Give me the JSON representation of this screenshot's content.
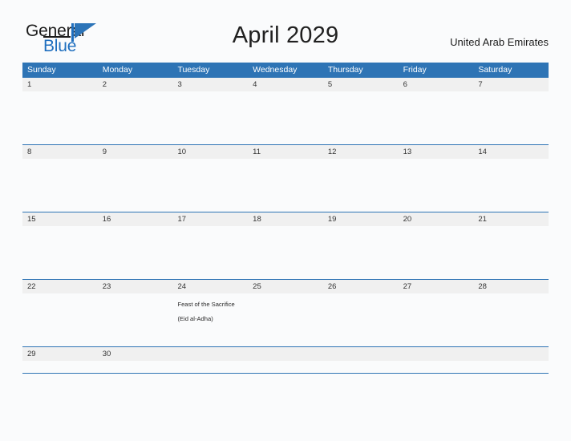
{
  "brand": {
    "name_part1": "General",
    "name_part2": "Blue",
    "mark": "triangle-flag-icon",
    "colors": {
      "primary_blue": "#2e74b5",
      "logo_blue": "#1f6fbf",
      "text_dark": "#1c1c1c"
    }
  },
  "header": {
    "title": "April 2029",
    "country": "United Arab Emirates"
  },
  "calendar": {
    "month": "April",
    "year": "2029",
    "weekdays": [
      "Sunday",
      "Monday",
      "Tuesday",
      "Wednesday",
      "Thursday",
      "Friday",
      "Saturday"
    ],
    "weeks": [
      {
        "days": [
          {
            "num": "1",
            "event": ""
          },
          {
            "num": "2",
            "event": ""
          },
          {
            "num": "3",
            "event": ""
          },
          {
            "num": "4",
            "event": ""
          },
          {
            "num": "5",
            "event": ""
          },
          {
            "num": "6",
            "event": ""
          },
          {
            "num": "7",
            "event": ""
          }
        ]
      },
      {
        "days": [
          {
            "num": "8",
            "event": ""
          },
          {
            "num": "9",
            "event": ""
          },
          {
            "num": "10",
            "event": ""
          },
          {
            "num": "11",
            "event": ""
          },
          {
            "num": "12",
            "event": ""
          },
          {
            "num": "13",
            "event": ""
          },
          {
            "num": "14",
            "event": ""
          }
        ]
      },
      {
        "days": [
          {
            "num": "15",
            "event": ""
          },
          {
            "num": "16",
            "event": ""
          },
          {
            "num": "17",
            "event": ""
          },
          {
            "num": "18",
            "event": ""
          },
          {
            "num": "19",
            "event": ""
          },
          {
            "num": "20",
            "event": ""
          },
          {
            "num": "21",
            "event": ""
          }
        ]
      },
      {
        "days": [
          {
            "num": "22",
            "event": ""
          },
          {
            "num": "23",
            "event": ""
          },
          {
            "num": "24",
            "event": "Feast of the Sacrifice (Eid al-Adha)"
          },
          {
            "num": "25",
            "event": ""
          },
          {
            "num": "26",
            "event": ""
          },
          {
            "num": "27",
            "event": ""
          },
          {
            "num": "28",
            "event": ""
          }
        ]
      },
      {
        "days": [
          {
            "num": "29",
            "event": ""
          },
          {
            "num": "30",
            "event": ""
          },
          {
            "num": "",
            "event": ""
          },
          {
            "num": "",
            "event": ""
          },
          {
            "num": "",
            "event": ""
          },
          {
            "num": "",
            "event": ""
          },
          {
            "num": "",
            "event": ""
          }
        ]
      }
    ]
  }
}
